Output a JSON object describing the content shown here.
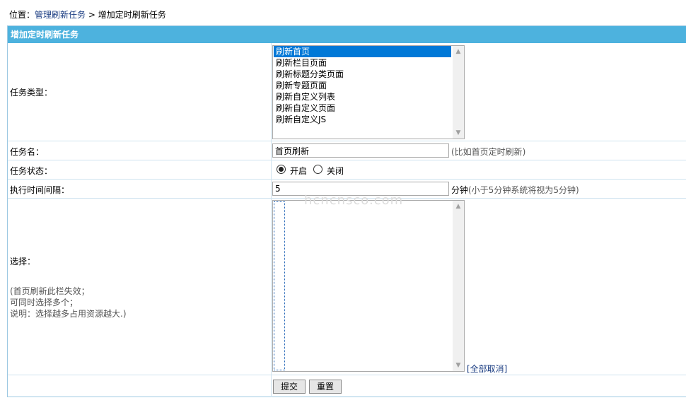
{
  "breadcrumb": {
    "prefix": "位置：",
    "link": "管理刷新任务",
    "separator": " > ",
    "current": "增加定时刷新任务"
  },
  "panel": {
    "title": "增加定时刷新任务"
  },
  "task_type": {
    "label": "任务类型：",
    "options": [
      "刷新首页",
      "刷新栏目页面",
      "刷新标题分类页面",
      "刷新专题页面",
      "刷新自定义列表",
      "刷新自定义页面",
      "刷新自定义JS"
    ],
    "selected_index": 0
  },
  "task_name": {
    "label": "任务名：",
    "value": "首页刷新",
    "hint": "(比如首页定时刷新)"
  },
  "task_status": {
    "label": "任务状态：",
    "on_label": "开启",
    "off_label": "关闭",
    "selected": "on"
  },
  "interval": {
    "label": "执行时间间隔：",
    "value": "5",
    "unit": "分钟",
    "hint": "(小于5分钟系统将视为5分钟)"
  },
  "selection": {
    "label": "选择：",
    "note_line1": "(首页刷新此栏失效；",
    "note_line2": "可同时选择多个；",
    "note_line3": "说明：选择越多占用资源越大.)",
    "clear_all": "[全部取消]"
  },
  "buttons": {
    "submit": "提交",
    "reset": "重置"
  },
  "watermark": "hcncnsco.com"
}
